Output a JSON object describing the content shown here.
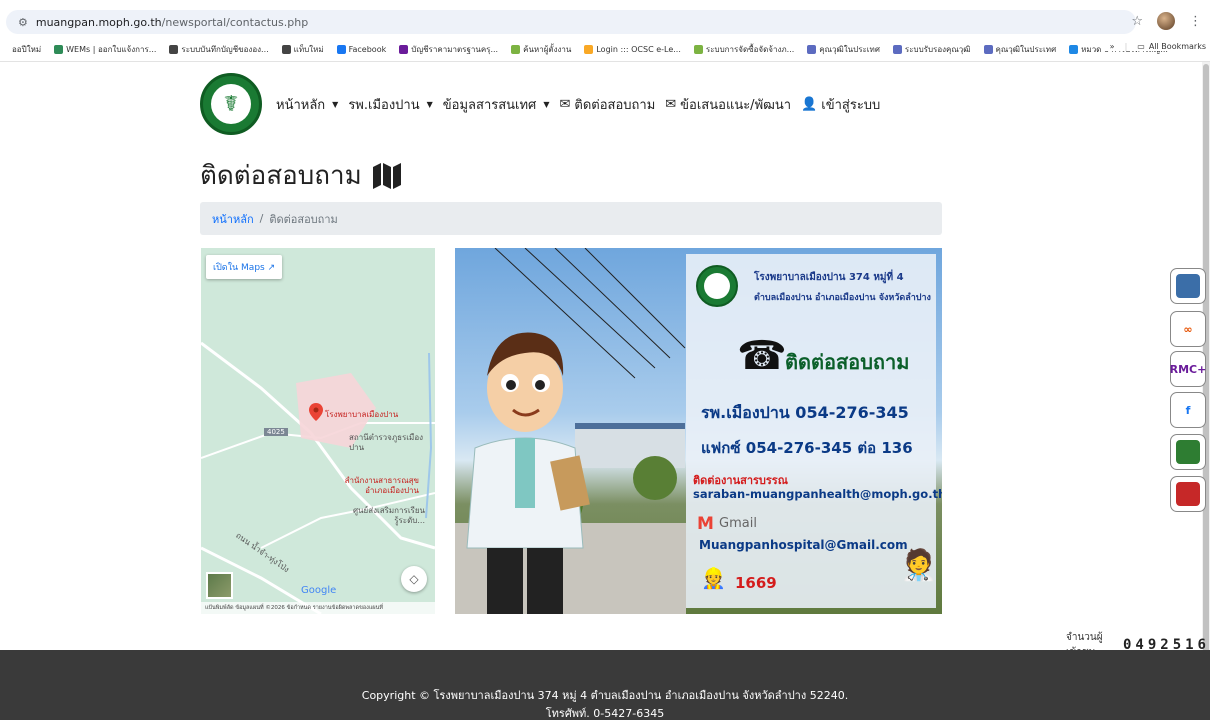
{
  "browser": {
    "url_host": "muangpan.moph.go.th",
    "url_path": "/newsportal/contactus.php",
    "bookmarks": [
      {
        "label": "ออปีใหม่",
        "color": "#ffffff"
      },
      {
        "label": "WEMs | ออกใบแจ้งการ...",
        "color": "#2e8b57"
      },
      {
        "label": "ระบบบันทึกบัญชีขององ...",
        "color": "#444444"
      },
      {
        "label": "แท็บใหม่",
        "color": "#444444"
      },
      {
        "label": "Facebook",
        "color": "#1877f2"
      },
      {
        "label": "บัญชีราคามาตรฐานครุ...",
        "color": "#6a1b9a"
      },
      {
        "label": "ค้นหาผู้ตั้งงาน",
        "color": "#7cb342"
      },
      {
        "label": "Login ::: OCSC e-Le...",
        "color": "#f9a825"
      },
      {
        "label": "ระบบการจัดซื้อจัดจ้างภ...",
        "color": "#7cb342"
      },
      {
        "label": "คุณวุฒิในประเทศ",
        "color": "#5c6bc0"
      },
      {
        "label": "ระบบรับรองคุณวุฒิ",
        "color": "#5c6bc0"
      },
      {
        "label": "คุณวุฒิในประเทศ",
        "color": "#5c6bc0"
      },
      {
        "label": "หมวด 6 การบริหารสัญ...",
        "color": "#1e88e5"
      }
    ],
    "more": "»",
    "all_bookmarks": "All Bookmarks"
  },
  "nav": {
    "items": [
      {
        "label": "หน้าหลัก",
        "caret": true,
        "icon": ""
      },
      {
        "label": "รพ.เมืองปาน",
        "caret": true,
        "icon": ""
      },
      {
        "label": "ข้อมูลสารสนเทศ",
        "caret": true,
        "icon": ""
      },
      {
        "label": "ติดต่อสอบถาม",
        "caret": false,
        "icon": "envelope"
      },
      {
        "label": "ข้อเสนอแนะ/พัฒนา",
        "caret": false,
        "icon": "envelope"
      },
      {
        "label": "เข้าสู่ระบบ",
        "caret": false,
        "icon": "user"
      }
    ]
  },
  "page": {
    "title": "ติดต่อสอบถาม",
    "breadcrumb": {
      "home": "หน้าหลัก",
      "sep": "/",
      "current": "ติดต่อสอบถาม"
    }
  },
  "map": {
    "open_in_maps": "เปิดใน Maps",
    "hospital_label": "โรงพยาบาลเมืองปาน",
    "police_label": "สถานีตำรวจภูธรเมืองปาน",
    "health_office_label": "สำนักงานสาธารณสุขอำเภอเมืองปาน",
    "learning_center_label": "ศูนย์ส่งเสริมการเรียนรู้ระดับ...",
    "road_badge": "4025",
    "road_name": "ถนน น้ำจำ-ทุ่งโป่ง",
    "google": "Google",
    "footer": "แป้นพิมพ์ลัด   ข้อมูลแผนที่ ©2026   ข้อกำหนด   รายงานข้อผิดพลาดของแผนที่"
  },
  "banner": {
    "hospital_line1": "โรงพยาบาลเมืองปาน 374 หมู่ที่ 4",
    "hospital_line2": "ตำบลเมืองปาน อำเภอเมืองปาน จังหวัดลำปาง",
    "contact_heading": "ติดต่อสอบถาม",
    "phone_line": "รพ.เมืองปาน 054-276-345",
    "fax_line": "แฟกซ์ 054-276-345 ต่อ 136",
    "saraban_label": "ติดต่องานสารบรรณ",
    "saraban_email": "saraban-muangpanhealth@moph.go.th",
    "gmail_label": "Gmail",
    "gmail_email": "Muangpanhospital@Gmail.com",
    "emergency_number": "1669"
  },
  "side_icons": [
    {
      "name": "hospital-emblem-icon",
      "label": "",
      "color": "#3b6ea8"
    },
    {
      "name": "link-icon",
      "label": "∞",
      "color": "#e65100"
    },
    {
      "name": "rmc-icon",
      "label": "RMC+",
      "color": "#6a1b9a"
    },
    {
      "name": "facebook-icon",
      "label": "f",
      "color": "#1877f2"
    },
    {
      "name": "dashboard-icon",
      "label": "",
      "color": "#2e7d32"
    },
    {
      "name": "youtube-icon",
      "label": "",
      "color": "#c62828"
    }
  ],
  "visitors": {
    "label": "จำนวนผู้เข้าชม",
    "count": "0492516"
  },
  "footer": {
    "line1": "Copyright © โรงพยาบาลเมืองปาน 374 หมู่ 4 ตำบลเมืองปาน อำเภอเมืองปาน จังหวัดลำปาง 52240.",
    "line2": "โทรศัพท์. 0-5427-6345"
  }
}
